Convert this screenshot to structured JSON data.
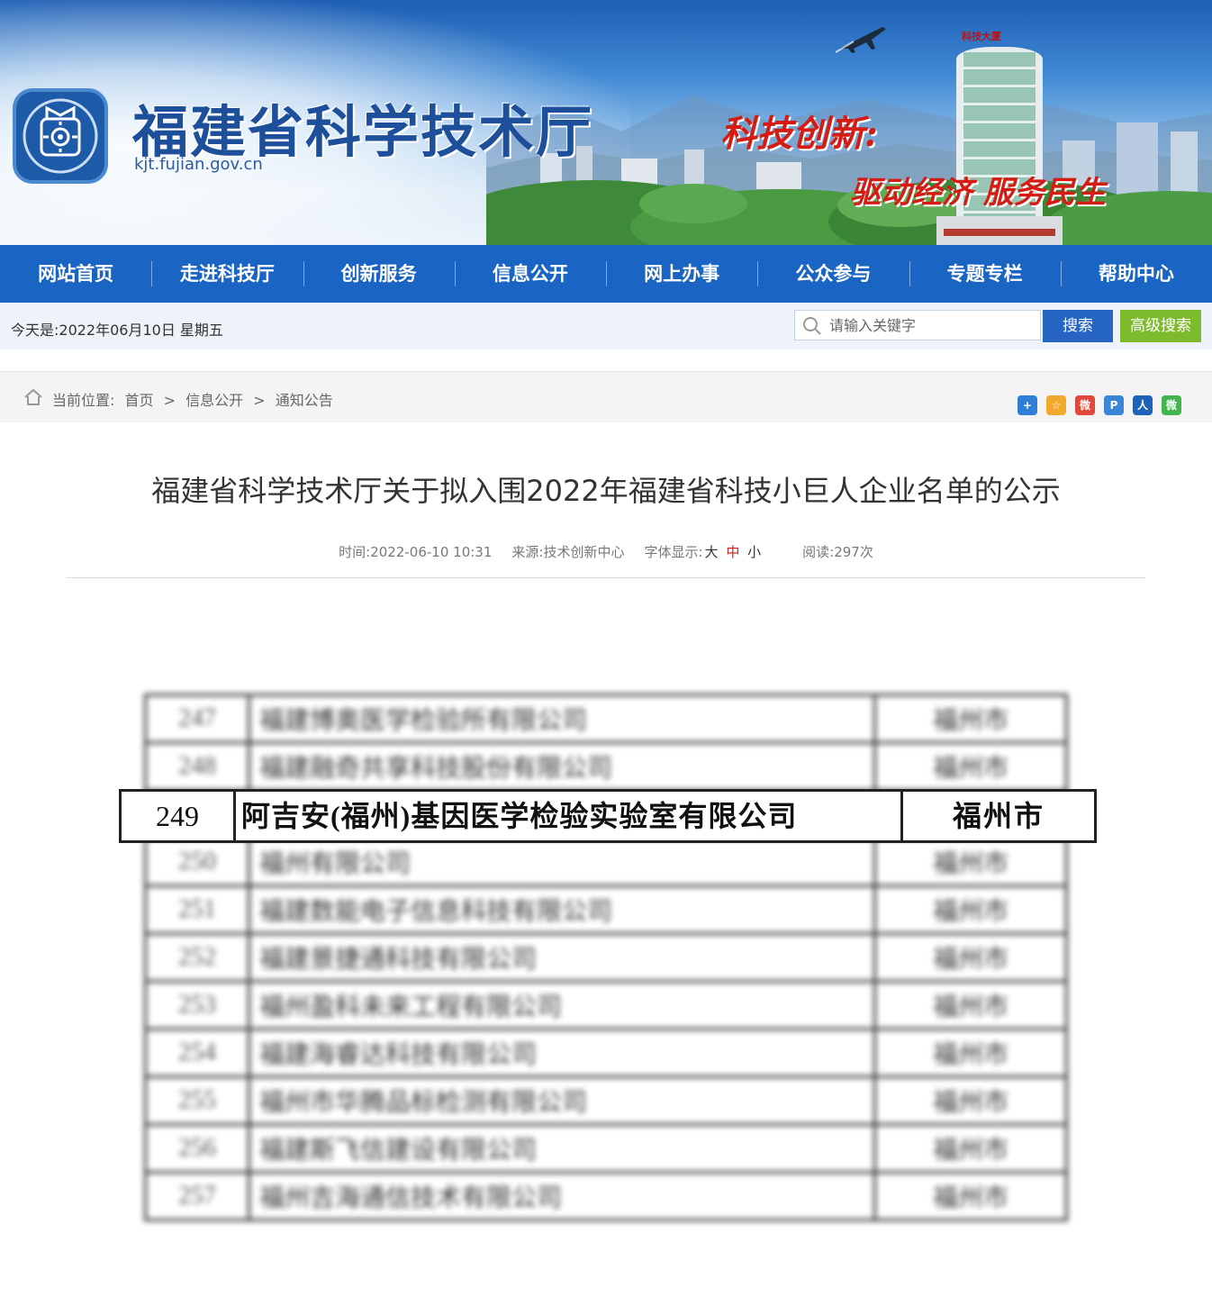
{
  "header": {
    "site_title": "福建省科学技术厅",
    "site_url": "kjt.fujian.gov.cn",
    "slogan_line1": "科技创新:",
    "slogan_line2": "驱动经济 服务民生",
    "tower_sign": "科技大厦"
  },
  "nav": {
    "items": [
      {
        "label": "网站首页"
      },
      {
        "label": "走进科技厅"
      },
      {
        "label": "创新服务"
      },
      {
        "label": "信息公开"
      },
      {
        "label": "网上办事"
      },
      {
        "label": "公众参与"
      },
      {
        "label": "专题专栏"
      },
      {
        "label": "帮助中心"
      }
    ]
  },
  "topbar": {
    "date_text": "今天是:2022年06月10日 星期五",
    "search_placeholder": "请输入关键字",
    "search_button": "搜索",
    "advanced_search": "高级搜索"
  },
  "breadcrumb": {
    "prefix": "当前位置:",
    "items": [
      "首页",
      ">",
      "信息公开",
      ">",
      "通知公告"
    ]
  },
  "share_icons": [
    {
      "name": "add-share-icon",
      "glyph": "+",
      "color": "#2f7fd8"
    },
    {
      "name": "qzone-share-icon",
      "glyph": "☆",
      "color": "#f1a92b"
    },
    {
      "name": "weibo-share-icon",
      "glyph": "微",
      "color": "#e1483a"
    },
    {
      "name": "tencent-share-icon",
      "glyph": "P",
      "color": "#3a86d6"
    },
    {
      "name": "renren-share-icon",
      "glyph": "人",
      "color": "#1f63b8"
    },
    {
      "name": "wechat-share-icon",
      "glyph": "微",
      "color": "#43b54c"
    }
  ],
  "article": {
    "title": "福建省科学技术厅关于拟入围2022年福建省科技小巨人企业名单的公示",
    "time_label": "时间:",
    "time_value": "2022-06-10 10:31",
    "source_label": "来源:",
    "source_value": "技术创新中心",
    "fontsize_label": "字体显示:",
    "size_large": "大",
    "size_medium": "中",
    "size_small": "小",
    "reads_label": "阅读:",
    "reads_value": "297次"
  },
  "table": {
    "blurred_rows": [
      {
        "no": "247",
        "company": "福建博奥医学检验所有限公司",
        "city": "福州市"
      },
      {
        "no": "248",
        "company": "福建融奇共享科技股份有限公司",
        "city": "福州市"
      },
      {
        "no": "",
        "company": "",
        "city": ""
      },
      {
        "no": "250",
        "company": "福州有限公司",
        "city": "福州市"
      },
      {
        "no": "251",
        "company": "福建数能电子信息科技有限公司",
        "city": "福州市"
      },
      {
        "no": "252",
        "company": "福建景捷通科技有限公司",
        "city": "福州市"
      },
      {
        "no": "253",
        "company": "福州盈科未来工程有限公司",
        "city": "福州市"
      },
      {
        "no": "254",
        "company": "福建海睿达科技有限公司",
        "city": "福州市"
      },
      {
        "no": "255",
        "company": "福州市华腾品标检测有限公司",
        "city": "福州市"
      },
      {
        "no": "256",
        "company": "福建斯飞信建设有限公司",
        "city": "福州市"
      },
      {
        "no": "257",
        "company": "福州吉海通信技术有限公司",
        "city": "福州市"
      }
    ],
    "highlight": {
      "no": "249",
      "company": "阿吉安(福州)基因医学检验实验室有限公司",
      "city": "福州市"
    }
  }
}
